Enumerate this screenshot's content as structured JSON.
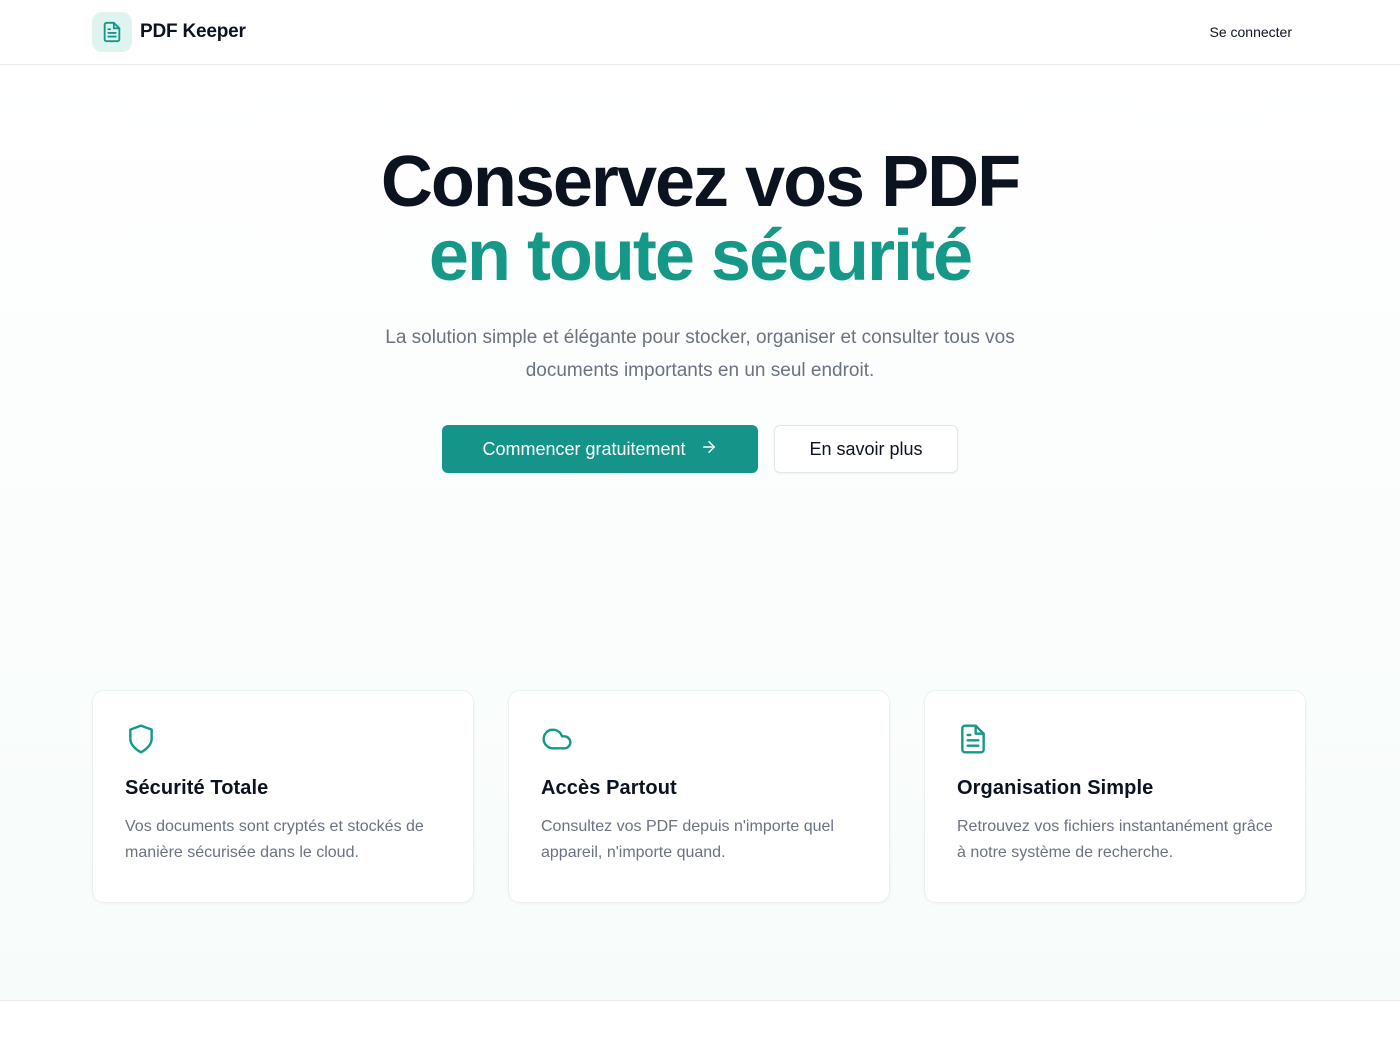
{
  "header": {
    "brand_name": "PDF Keeper",
    "brand_icon": "file-text-icon",
    "login_label": "Se connecter"
  },
  "hero": {
    "title_line1": "Conservez vos PDF",
    "title_line2": "en toute sécurité",
    "subtitle": "La solution simple et élégante pour stocker, organiser et consulter tous vos documents importants en un seul endroit.",
    "primary_cta": "Commencer gratuitement",
    "primary_cta_icon": "arrow-right-icon",
    "secondary_cta": "En savoir plus"
  },
  "features": [
    {
      "icon": "shield-icon",
      "title": "Sécurité Totale",
      "text": "Vos documents sont cryptés et stockés de manière sécurisée dans le cloud."
    },
    {
      "icon": "cloud-icon",
      "title": "Accès Partout",
      "text": "Consultez vos PDF depuis n'importe quel appareil, n'importe quand."
    },
    {
      "icon": "file-text-icon",
      "title": "Organisation Simple",
      "text": "Retrouvez vos fichiers instantanément grâce à notre système de recherche."
    }
  ],
  "colors": {
    "accent": "#159887",
    "brand_icon_bg": "#dff3ef",
    "text_primary": "#0b1220",
    "text_muted": "#6b7280"
  }
}
